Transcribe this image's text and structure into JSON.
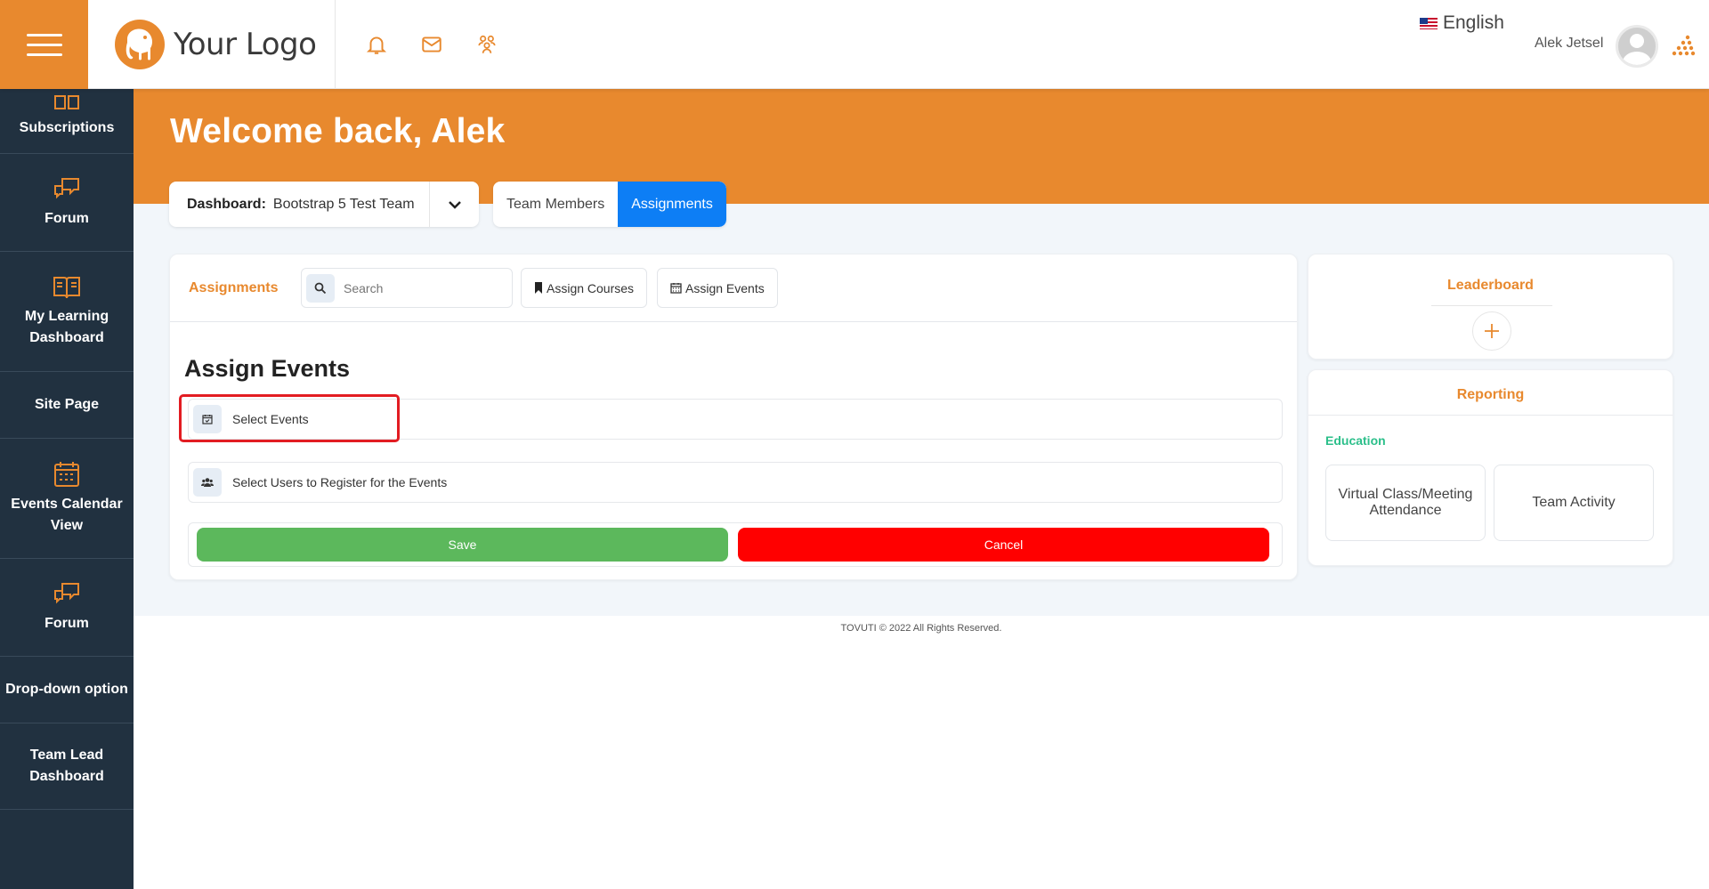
{
  "header": {
    "logo_text": "Your Logo",
    "language": "English",
    "user_name": "Alek Jetsel"
  },
  "sidebar": {
    "items": [
      {
        "label": "Subscriptions",
        "icon": "grid-icon"
      },
      {
        "label": "Forum",
        "icon": "chat-bubbles-icon"
      },
      {
        "label": "My Learning Dashboard",
        "icon": "open-book-icon"
      },
      {
        "label": "Site Page",
        "icon": ""
      },
      {
        "label": "Events Calendar View",
        "icon": "calendar-icon"
      },
      {
        "label": "Forum",
        "icon": "chat-bubbles-icon"
      },
      {
        "label": "Drop-down option",
        "icon": ""
      },
      {
        "label": "Team Lead Dashboard",
        "icon": ""
      }
    ]
  },
  "banner": {
    "welcome": "Welcome back, Alek"
  },
  "dashboard_select": {
    "label": "Dashboard:",
    "value": "Bootstrap 5 Test Team"
  },
  "tabs": [
    {
      "label": "Team Members",
      "active": false
    },
    {
      "label": "Assignments",
      "active": true
    }
  ],
  "assignments": {
    "title": "Assignments",
    "search_placeholder": "Search",
    "assign_courses": "Assign Courses",
    "assign_events": "Assign Events",
    "section_title": "Assign Events",
    "select_events": "Select Events",
    "select_users": "Select Users to Register for the Events",
    "save": "Save",
    "cancel": "Cancel"
  },
  "leaderboard": {
    "title": "Leaderboard"
  },
  "reporting": {
    "title": "Reporting",
    "category": "Education",
    "tiles": [
      "Virtual Class/Meeting Attendance",
      "Team Activity"
    ]
  },
  "footer": {
    "text": "TOVUTI © 2022 All Rights Reserved."
  },
  "colors": {
    "brand_orange": "#e8892e",
    "sidebar_dark": "#213140",
    "active_tab_blue": "#0d7ef5",
    "save_green": "#5cb85c",
    "cancel_red": "#ff0000",
    "education_green": "#2bbf8a"
  }
}
